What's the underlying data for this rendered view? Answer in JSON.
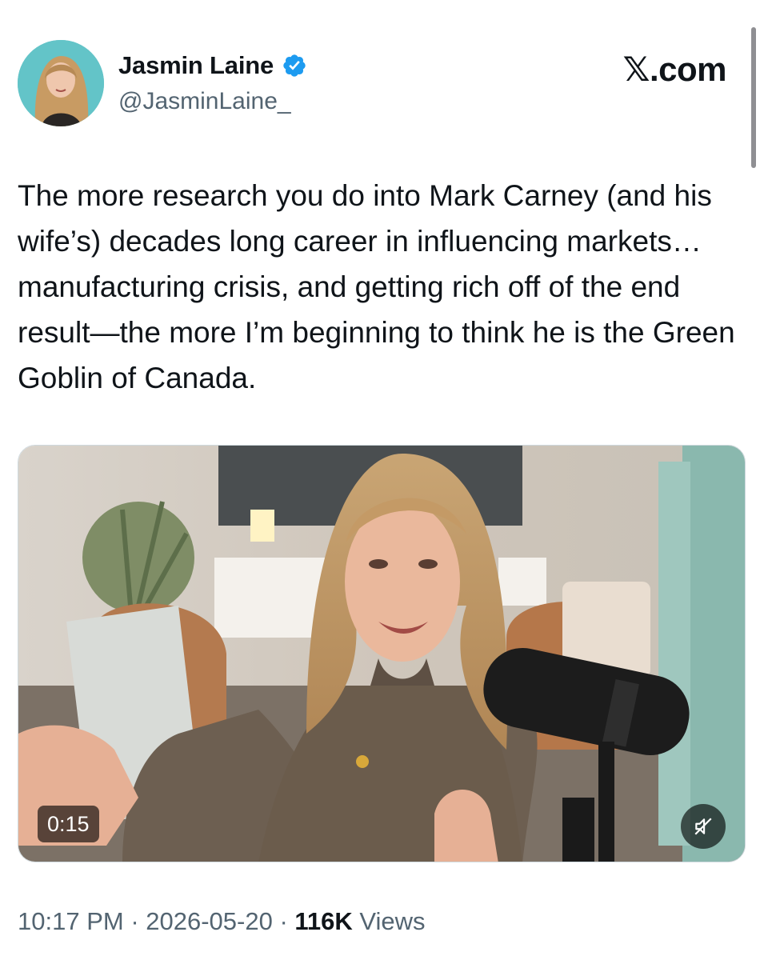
{
  "author": {
    "display_name": "Jasmin Laine",
    "handle": "@JasminLaine_",
    "verified": true,
    "avatar_icon": "profile-photo"
  },
  "site": {
    "label": "𝕏.com"
  },
  "tweet": {
    "text": "The more research you do into Mark Carney (and his wife’s) decades long career in influencing markets… manufacturing crisis, and getting rich off of the end result—the more I’m beginning to think he is the Green Goblin of Canada."
  },
  "media": {
    "type": "video",
    "duration": "0:15",
    "muted": true,
    "mute_icon": "muted-speaker-icon"
  },
  "meta": {
    "time": "10:17 PM",
    "separator": " · ",
    "date": "2026-05-20",
    "views_count": "116K",
    "views_label": " Views"
  },
  "colors": {
    "text_primary": "#0f1419",
    "text_secondary": "#536471",
    "verified_blue": "#1d9bf0"
  }
}
